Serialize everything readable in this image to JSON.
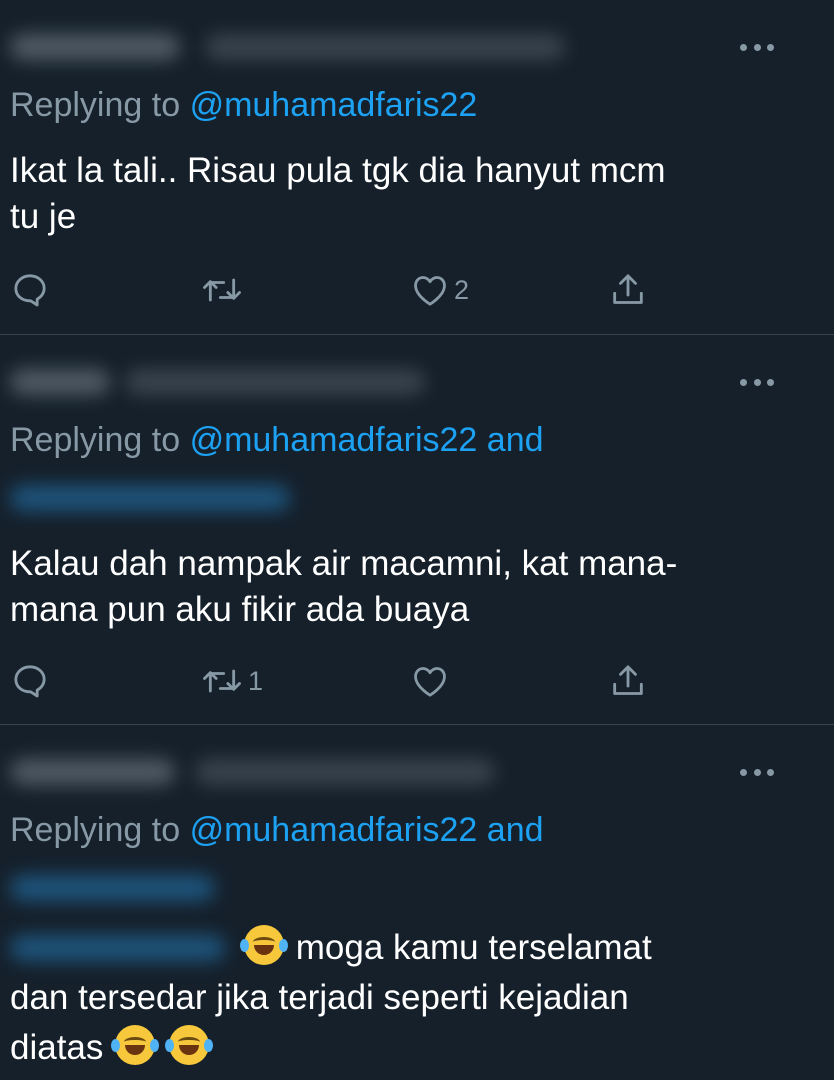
{
  "colors": {
    "background": "#15202b",
    "divider": "#38444d",
    "muted": "#8899a6",
    "link": "#1da1f2",
    "text": "#ffffff"
  },
  "tweets": [
    {
      "reply_prefix": "Replying to",
      "reply_handle": "@muhamadfaris22",
      "reply_suffix": "",
      "text_lines": [
        "Ikat la tali.. Risau pula tgk dia hanyut mcm",
        "tu je"
      ],
      "actions": {
        "reply_icon": "reply-icon",
        "retweet_icon": "retweet-icon",
        "retweet_count": "",
        "like_icon": "heart-icon",
        "like_count": "2",
        "share_icon": "share-icon"
      }
    },
    {
      "reply_prefix": "Replying to",
      "reply_handle": "@muhamadfaris22",
      "reply_suffix": "and",
      "text_lines": [
        "Kalau dah nampak air macamni, kat mana-",
        "mana pun aku fikir ada buaya"
      ],
      "actions": {
        "reply_icon": "reply-icon",
        "retweet_icon": "retweet-icon",
        "retweet_count": "1",
        "like_icon": "heart-icon",
        "like_count": "",
        "share_icon": "share-icon"
      }
    },
    {
      "reply_prefix": "Replying to",
      "reply_handle": "@muhamadfaris22",
      "reply_suffix": "and",
      "text_line1": "moga kamu terselamat",
      "text_line2": "dan tersedar jika terjadi seperti kejadian",
      "text_line3": "diatas"
    }
  ]
}
